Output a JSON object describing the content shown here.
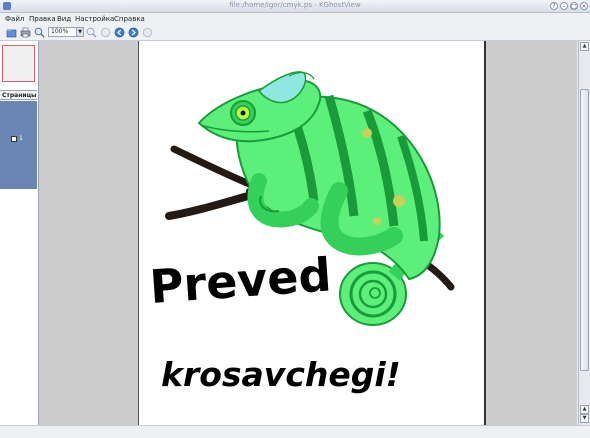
{
  "window": {
    "title": "file:/home/igor/cmyk.ps - KGhostView"
  },
  "menu": {
    "items": [
      {
        "label": "Файл"
      },
      {
        "label": "Правка"
      },
      {
        "label": "Вид"
      },
      {
        "label": "Настройка"
      },
      {
        "label": "Справка"
      }
    ]
  },
  "toolbar": {
    "zoom_value": "100%",
    "icons": [
      "open-icon",
      "print-icon",
      "zoom-in-icon",
      "zoom-out-icon",
      "fit-page-icon",
      "prev-page-icon",
      "next-page-icon",
      "last-page-icon"
    ]
  },
  "sidebar": {
    "pages_header": "Страницы",
    "page_number": "1"
  },
  "document": {
    "word_preved": "Preved",
    "word_krosavchegi": "krosavchegi!"
  },
  "status": {
    "text": ""
  },
  "colors": {
    "chameleon_light": "#5cf07a",
    "chameleon_dark": "#1a9b3a",
    "chameleon_mid": "#34d05a",
    "branch": "#231a14",
    "eye": "#b9ff3a",
    "crest": "#8fe8e0",
    "spot": "#c9cf5a"
  }
}
